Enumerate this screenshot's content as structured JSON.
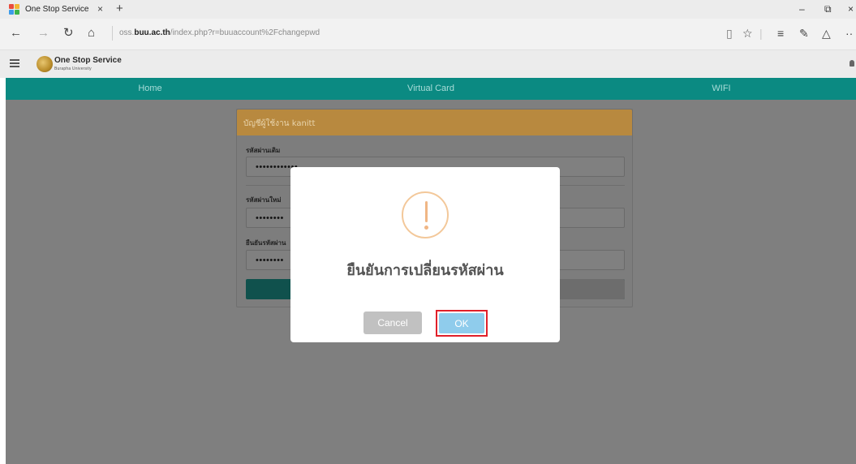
{
  "browser": {
    "tab_title": "One Stop Service",
    "tab_close": "×",
    "new_tab": "+",
    "url_prefix": "oss.",
    "url_domain": "buu.ac.th",
    "url_path": "/index.php?r=buuaccount%2Fchangepwd",
    "window_controls": {
      "minimize": "–",
      "restore": "⧉",
      "close": "×"
    }
  },
  "site": {
    "logo_main": "One Stop Service",
    "logo_sub": "Burapha University"
  },
  "nav": {
    "items": [
      "Home",
      "Virtual Card",
      "WIFI"
    ]
  },
  "form": {
    "title": "บัญชีผู้ใช้งาน kanitt",
    "fields": [
      {
        "label": "รหัสผ่านเดิม",
        "value": "••••••••••••"
      },
      {
        "label": "รหัสผ่านใหม่",
        "value": "••••••••"
      },
      {
        "label": "ยืนยันรหัสผ่าน",
        "value": "••••••••"
      }
    ]
  },
  "modal": {
    "title": "ยืนยันการเปลี่ยนรหัสผ่าน",
    "cancel_label": "Cancel",
    "ok_label": "OK"
  },
  "colors": {
    "nav_teal": "#0b8a82",
    "panel_header": "#b8893f",
    "ok_button": "#8fccec",
    "cancel_button": "#c1c1c1",
    "highlight": "#e0202a",
    "warning_icon": "#f0b685"
  },
  "icons": {
    "back": "arrow-left-icon",
    "forward": "arrow-right-icon",
    "refresh": "refresh-icon",
    "home": "home-icon",
    "reading_view": "reading-view-icon",
    "favorite": "star-icon",
    "hub": "hub-icon",
    "web_note": "web-note-icon",
    "share": "share-icon",
    "more": "more-icon",
    "menu": "hamburger-icon",
    "alert": "warning-icon"
  }
}
